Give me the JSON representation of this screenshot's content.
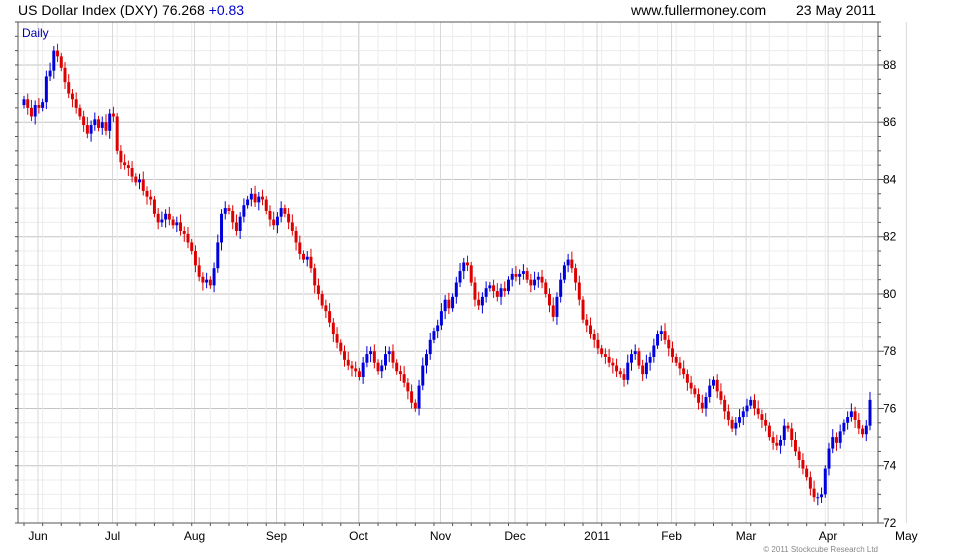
{
  "header": {
    "title": "US Dollar Index (DXY)",
    "last": "76.268",
    "change": "+0.83",
    "site": "www.fullermoney.com",
    "date": "23 May 2011"
  },
  "footer": {
    "copyright": "© 2011 Stockcube Research Ltd"
  },
  "colors": {
    "up": "#0000dd",
    "down": "#dd0000",
    "grid": "#c8c8c8",
    "frame": "#555555"
  },
  "chart_data": {
    "type": "candlestick",
    "period_label": "Daily",
    "ylim": [
      72,
      89.5
    ],
    "y_ticks": [
      72,
      74,
      76,
      78,
      80,
      82,
      84,
      86,
      88
    ],
    "x_months": [
      "Jun",
      "Jul",
      "Aug",
      "Sep",
      "Oct",
      "Nov",
      "Dec",
      "2011",
      "Feb",
      "Mar",
      "Apr",
      "May"
    ],
    "y_axis_side": "right",
    "grid": true,
    "closes": [
      86.8,
      86.5,
      86.2,
      86.6,
      86.5,
      86.7,
      87.6,
      87.8,
      88.5,
      88.3,
      87.9,
      87.4,
      87.0,
      86.8,
      86.5,
      86.2,
      85.9,
      85.6,
      85.9,
      86.1,
      85.8,
      86.0,
      85.7,
      86.3,
      86.2,
      85.0,
      84.6,
      84.5,
      84.4,
      84.1,
      83.9,
      84.0,
      83.6,
      83.4,
      83.3,
      82.8,
      82.5,
      82.6,
      82.8,
      82.6,
      82.4,
      82.5,
      82.2,
      82.1,
      81.8,
      81.5,
      81.0,
      80.6,
      80.4,
      80.5,
      80.3,
      80.9,
      81.8,
      82.8,
      83.0,
      82.9,
      82.5,
      82.2,
      82.7,
      83.1,
      83.3,
      83.5,
      83.2,
      83.4,
      83.3,
      82.9,
      82.6,
      82.4,
      82.7,
      83.0,
      82.8,
      82.5,
      82.2,
      81.8,
      81.4,
      81.2,
      81.3,
      80.9,
      80.3,
      80.0,
      79.6,
      79.4,
      79.0,
      78.6,
      78.3,
      78.0,
      77.7,
      77.5,
      77.4,
      77.3,
      77.1,
      77.6,
      77.9,
      78.0,
      77.6,
      77.3,
      77.5,
      77.9,
      78.0,
      77.6,
      77.3,
      77.2,
      76.9,
      76.6,
      76.2,
      76.0,
      76.8,
      77.5,
      77.9,
      78.4,
      78.7,
      78.9,
      79.4,
      79.8,
      79.5,
      79.9,
      80.4,
      80.8,
      81.1,
      81.0,
      80.4,
      79.8,
      79.6,
      79.9,
      80.2,
      80.3,
      80.1,
      79.9,
      80.2,
      80.1,
      80.5,
      80.7,
      80.6,
      80.7,
      80.8,
      80.5,
      80.3,
      80.5,
      80.6,
      80.4,
      80.0,
      79.6,
      79.2,
      79.9,
      80.5,
      81.0,
      81.2,
      80.9,
      80.4,
      79.8,
      79.1,
      78.9,
      78.6,
      78.4,
      78.1,
      77.9,
      77.8,
      77.6,
      77.5,
      77.3,
      77.2,
      77.0,
      77.6,
      77.9,
      78.0,
      77.5,
      77.2,
      77.6,
      77.8,
      78.2,
      78.6,
      78.7,
      78.4,
      78.1,
      77.8,
      77.6,
      77.4,
      77.2,
      76.9,
      76.7,
      76.5,
      76.2,
      76.0,
      76.4,
      76.8,
      77.0,
      76.6,
      76.3,
      75.9,
      75.6,
      75.3,
      75.5,
      75.7,
      75.9,
      76.1,
      76.3,
      76.0,
      75.8,
      75.6,
      75.4,
      75.0,
      74.8,
      74.7,
      74.9,
      75.4,
      75.3,
      74.9,
      74.5,
      74.2,
      73.9,
      73.6,
      73.2,
      72.9,
      72.9,
      73.0,
      73.9,
      74.6,
      75.0,
      74.8,
      75.2,
      75.5,
      75.7,
      75.9,
      75.6,
      75.3,
      75.1,
      75.4,
      76.3
    ],
    "month_start_index": [
      0,
      20,
      42,
      64,
      86,
      108,
      128,
      150,
      170,
      190,
      212,
      233
    ]
  }
}
